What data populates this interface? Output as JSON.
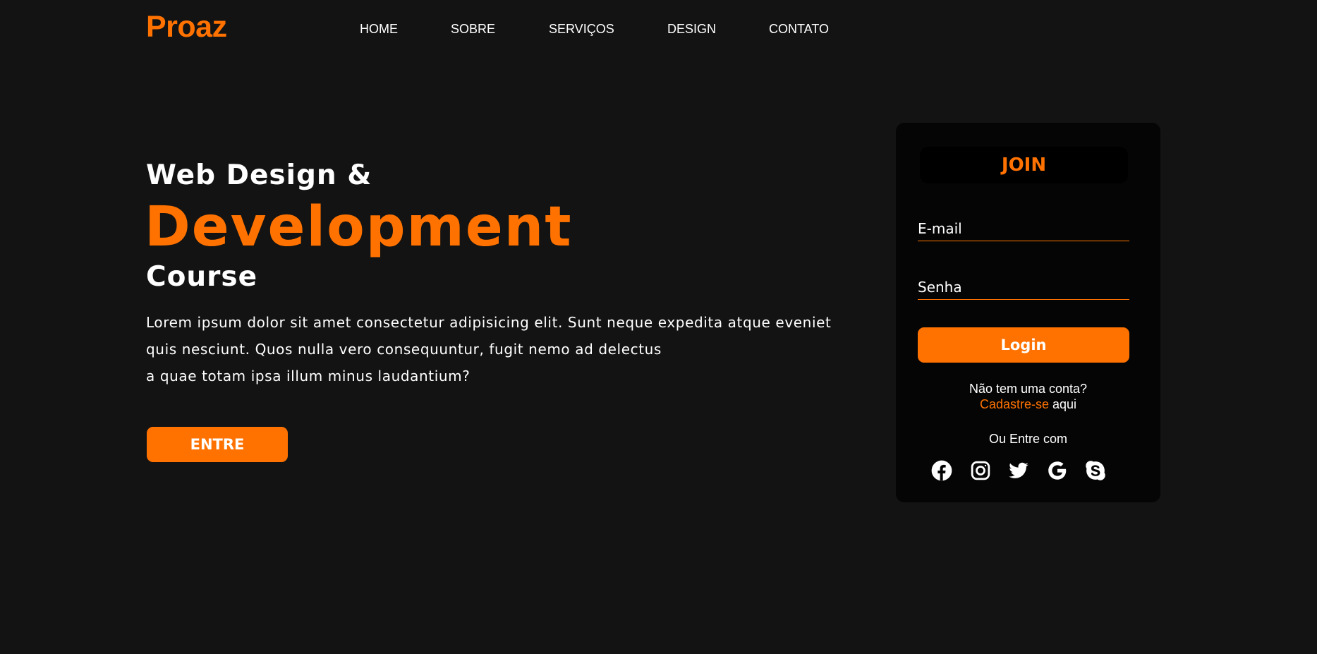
{
  "brand": {
    "logo": "Proaz",
    "accent_color": "#ff7200",
    "background_color": "#131313"
  },
  "nav": {
    "items": [
      {
        "label": "HOME"
      },
      {
        "label": "SOBRE"
      },
      {
        "label": "SERVIÇOS"
      },
      {
        "label": "DESIGN"
      },
      {
        "label": "CONTATO"
      }
    ]
  },
  "hero": {
    "line1": "Web Design &",
    "line2": "Development",
    "line3": "Course",
    "paragraph": [
      "Lorem ipsum dolor sit amet consectetur adipisicing elit. Sunt neque expedita atque eveniet",
      "quis nesciunt. Quos nulla vero consequuntur, fugit nemo ad delectus",
      "a quae totam ipsa illum minus laudantium?"
    ],
    "cta_label": "ENTRE"
  },
  "login": {
    "title": "JOIN",
    "email_placeholder": "E-mail",
    "password_placeholder": "Senha",
    "submit_label": "Login",
    "no_account_text": "Não tem uma conta?",
    "signup_link": "Cadastre-se",
    "signup_suffix": "aqui",
    "or_with": "Ou Entre com",
    "socials": [
      {
        "icon": "facebook-icon"
      },
      {
        "icon": "instagram-icon"
      },
      {
        "icon": "twitter-icon"
      },
      {
        "icon": "google-icon"
      },
      {
        "icon": "skype-icon"
      }
    ]
  }
}
